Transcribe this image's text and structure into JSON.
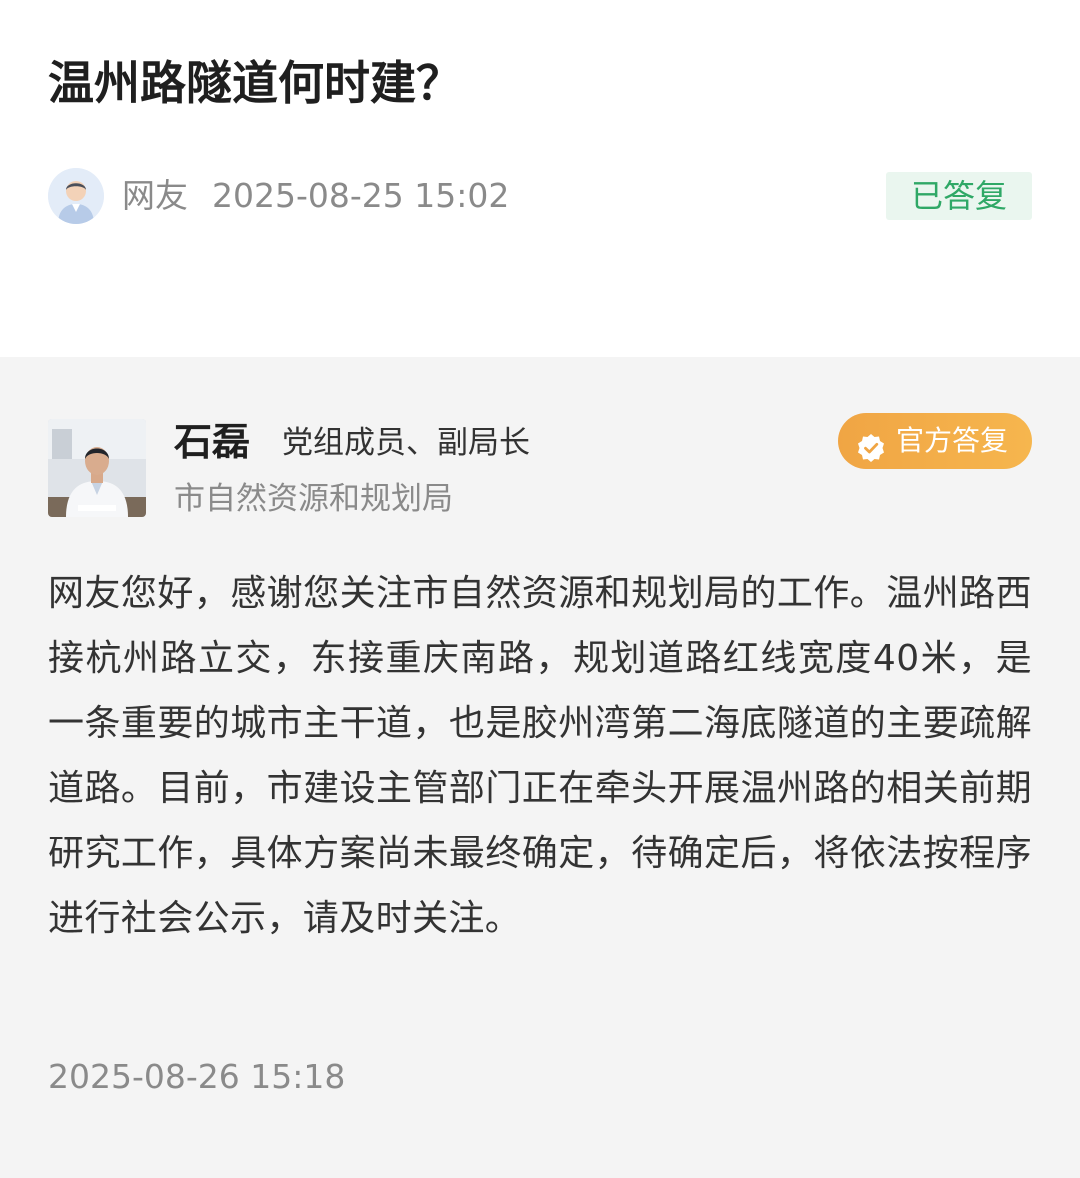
{
  "question": {
    "title": "温州路隧道何时建？",
    "asker_name": "网友",
    "asked_at": "2025-08-25 15:02",
    "status": "已答复",
    "avatar_icon": "user-avatar-icon"
  },
  "answer": {
    "name": "石磊",
    "role": "党组成员、副局长",
    "department": "市自然资源和规划局",
    "badge_label": "官方答复",
    "badge_icon": "verified-check-icon",
    "body": "网友您好，感谢您关注市自然资源和规划局的工作。温州路西接杭州路立交，东接重庆南路，规划道路红线宽度40米，是一条重要的城市主干道，也是胶州湾第二海底隧道的主要疏解道路。目前，市建设主管部门正在牵头开展温州路的相关前期研究工作，具体方案尚未最终确定，待确定后，将依法按程序进行社会公示，请及时关注。",
    "answered_at": "2025-08-26 15:18"
  },
  "colors": {
    "status_green": "#2fa866",
    "status_bg": "#eaf6ef",
    "official_orange": "#f2a845",
    "answer_bg": "#f4f4f4"
  }
}
